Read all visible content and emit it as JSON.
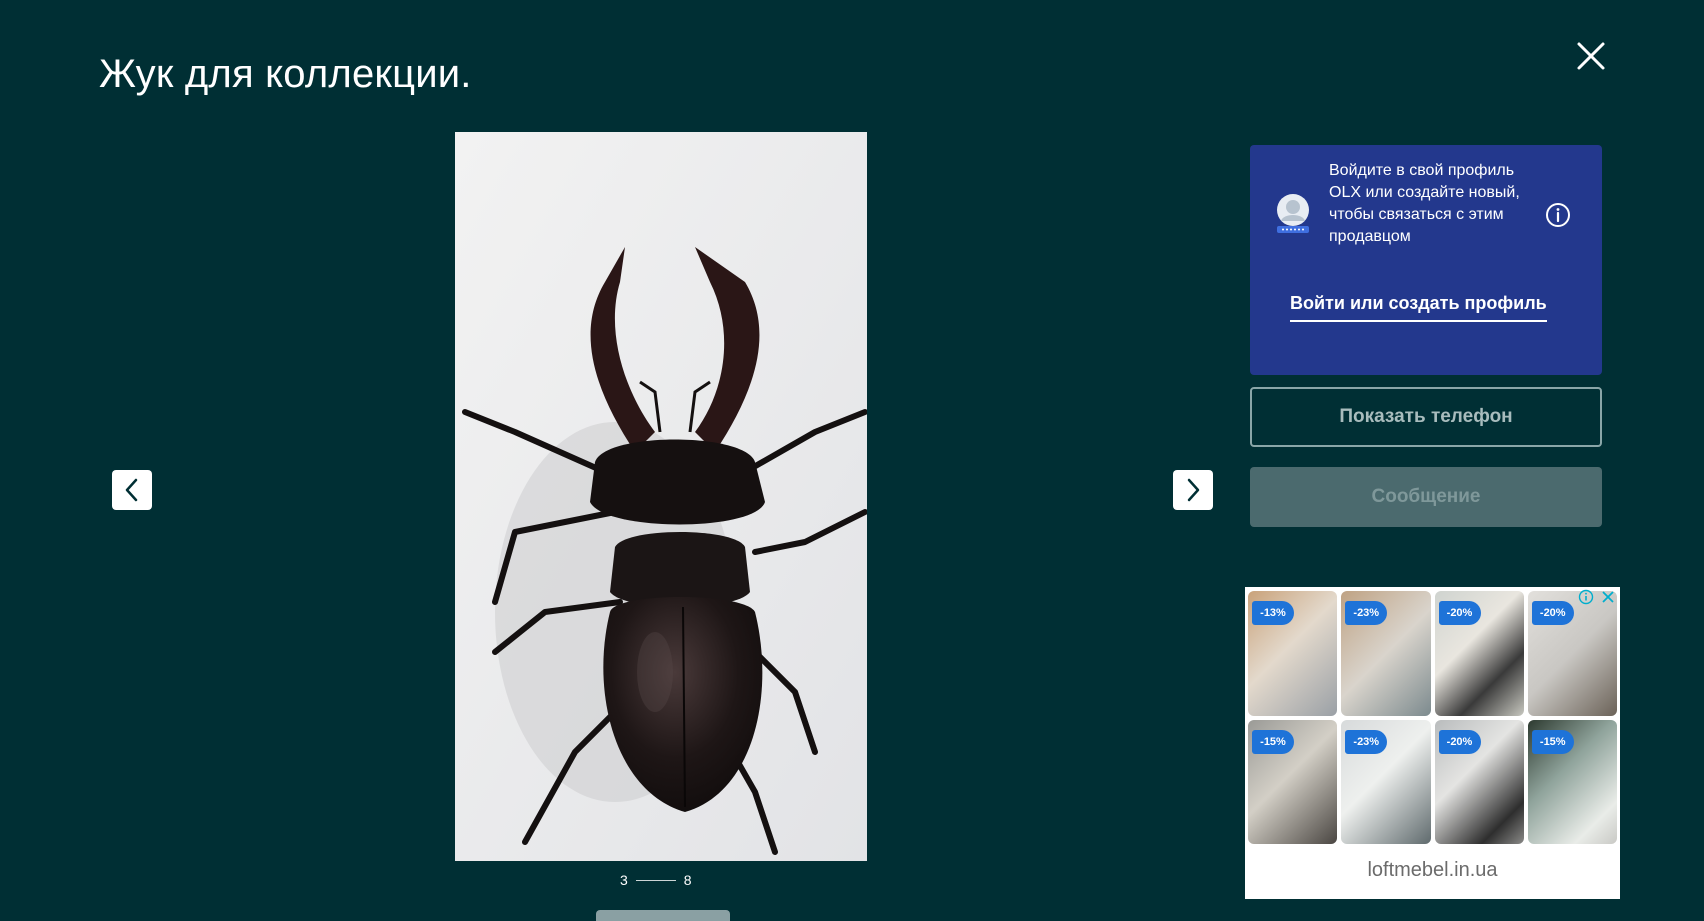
{
  "modal": {
    "title": "Жук для коллекции."
  },
  "gallery": {
    "current": "3",
    "total": "8",
    "colors": {
      "background": "#002f34",
      "photo_bg": "#efefef"
    }
  },
  "login_card": {
    "message": "Войдите в свой профиль OLX или создайте новый, чтобы связаться с этим продавцом",
    "link_label": "Войти или создать профиль",
    "color": "#23388d"
  },
  "actions": {
    "show_phone_label": "Показать телефон",
    "message_label": "Сообщение"
  },
  "ad": {
    "domain": "loftmebel.in.ua",
    "tiles": [
      {
        "discount": "-13%",
        "icon": "mirror-photo"
      },
      {
        "discount": "-23%",
        "icon": "mirror-photo"
      },
      {
        "discount": "-20%",
        "icon": "mirror-photo"
      },
      {
        "discount": "-20%",
        "icon": "mirror-photo"
      },
      {
        "discount": "-15%",
        "icon": "mirror-photo"
      },
      {
        "discount": "-23%",
        "icon": "mirror-photo"
      },
      {
        "discount": "-20%",
        "icon": "mirror-photo"
      },
      {
        "discount": "-15%",
        "icon": "mirror-photo"
      }
    ]
  }
}
